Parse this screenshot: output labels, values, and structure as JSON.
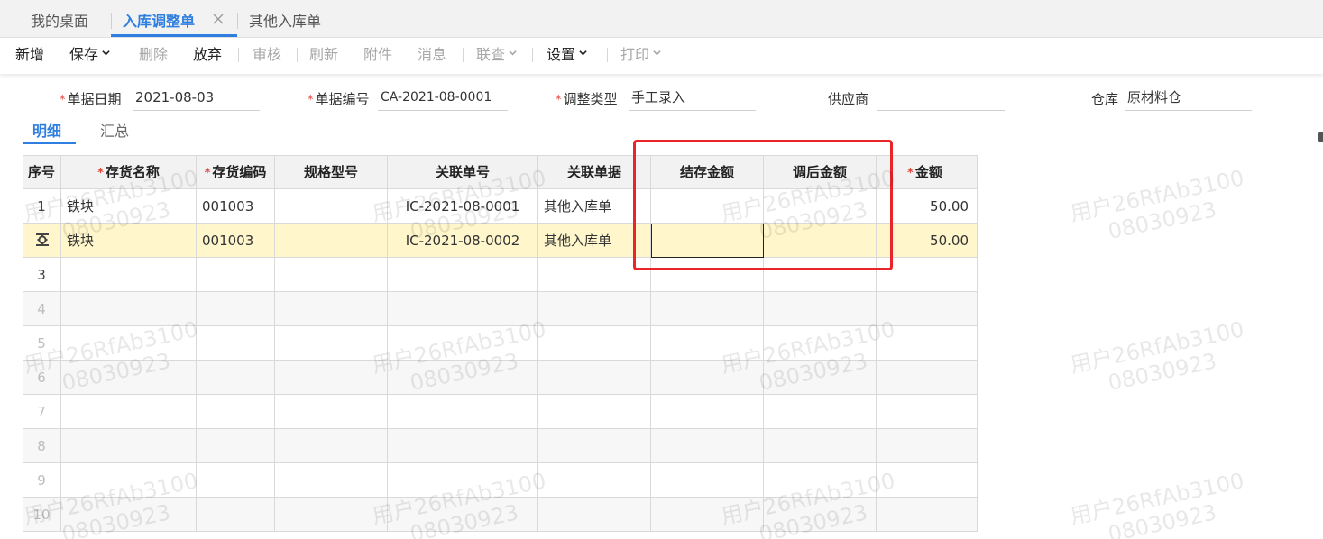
{
  "tabs": [
    {
      "label": "我的桌面",
      "active": false
    },
    {
      "label": "入库调整单",
      "active": true,
      "closable": true
    },
    {
      "label": "其他入库单",
      "active": false
    }
  ],
  "toolbar": {
    "items": [
      {
        "label": "新增",
        "enabled": true,
        "dropdown": false
      },
      {
        "label": "保存",
        "enabled": true,
        "dropdown": true
      },
      {
        "label": "删除",
        "enabled": false,
        "dropdown": false
      },
      {
        "label": "放弃",
        "enabled": true,
        "dropdown": false
      },
      {
        "label": "审核",
        "enabled": false,
        "dropdown": false
      },
      {
        "label": "刷新",
        "enabled": false,
        "dropdown": false
      },
      {
        "label": "附件",
        "enabled": false,
        "dropdown": false
      },
      {
        "label": "消息",
        "enabled": false,
        "dropdown": false
      },
      {
        "label": "联查",
        "enabled": false,
        "dropdown": true
      },
      {
        "label": "设置",
        "enabled": true,
        "dropdown": true
      },
      {
        "label": "打印",
        "enabled": false,
        "dropdown": true
      }
    ]
  },
  "form": {
    "doc_date": {
      "label": "单据日期",
      "value": "2021-08-03",
      "required": true
    },
    "doc_no": {
      "label": "单据编号",
      "value": "CA-2021-08-0001",
      "required": true
    },
    "adjust_type": {
      "label": "调整类型",
      "value": "手工录入",
      "required": true
    },
    "supplier": {
      "label": "供应商",
      "value": "",
      "required": false
    },
    "warehouse": {
      "label": "仓库",
      "value": "原材料仓",
      "required": false
    }
  },
  "subtabs": [
    {
      "label": "明细",
      "active": true
    },
    {
      "label": "汇总",
      "active": false
    }
  ],
  "grid": {
    "columns": [
      {
        "label": "序号",
        "required": false
      },
      {
        "label": "存货名称",
        "required": true
      },
      {
        "label": "存货编码",
        "required": true
      },
      {
        "label": "规格型号",
        "required": false
      },
      {
        "label": "关联单号",
        "required": false
      },
      {
        "label": "关联单据",
        "required": false
      },
      {
        "label": "结存金额",
        "required": false
      },
      {
        "label": "调后金额",
        "required": false
      },
      {
        "label": "金额",
        "required": true
      }
    ],
    "rows": [
      {
        "seq": "1",
        "name": "铁块",
        "code": "001003",
        "spec": "",
        "ref_no": "IC-2021-08-0001",
        "ref_doc": "其他入库单",
        "balance": "",
        "adjusted": "",
        "amount": "50.00"
      },
      {
        "seq": "",
        "name": "铁块",
        "code": "001003",
        "spec": "",
        "ref_no": "IC-2021-08-0002",
        "ref_doc": "其他入库单",
        "balance": "",
        "adjusted": "",
        "amount": "50.00",
        "selected": true
      },
      {
        "seq": "3"
      },
      {
        "seq": "4"
      },
      {
        "seq": "5"
      },
      {
        "seq": "6"
      },
      {
        "seq": "7"
      },
      {
        "seq": "8"
      },
      {
        "seq": "9"
      },
      {
        "seq": "10"
      }
    ]
  },
  "watermark": {
    "line1": "用户26RfAb3100",
    "line2": "08030923"
  },
  "colors": {
    "accent": "#2f7fe0",
    "required": "#e0483a",
    "highlight": "#e8262a",
    "selected_row": "#fff6cc"
  }
}
